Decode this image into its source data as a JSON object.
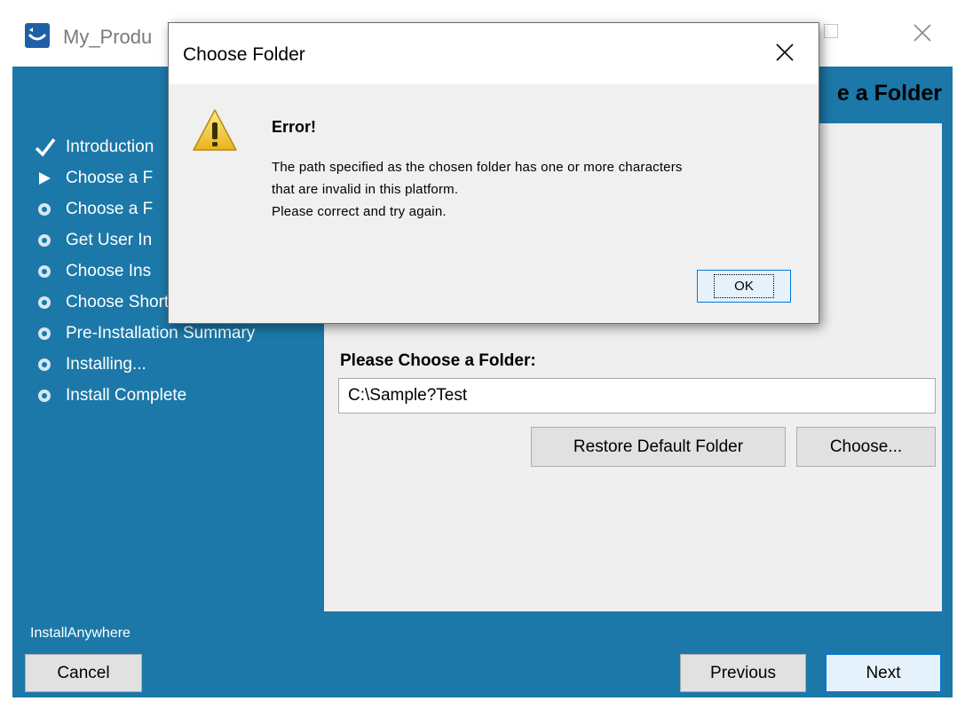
{
  "window": {
    "title": "My_Produ",
    "heading": "e a Folder"
  },
  "steps": [
    {
      "label": "Introduction",
      "state": "done",
      "icon": "checkmark-icon"
    },
    {
      "label": "Choose a F",
      "state": "current",
      "icon": "arrow-right-icon"
    },
    {
      "label": "Choose a F",
      "state": "pending",
      "icon": "bullet-icon"
    },
    {
      "label": "Get User In",
      "state": "pending",
      "icon": "bullet-icon"
    },
    {
      "label": "Choose Ins",
      "state": "pending",
      "icon": "bullet-icon"
    },
    {
      "label": "Choose Shortcut Folder",
      "state": "pending",
      "icon": "bullet-icon"
    },
    {
      "label": "Pre-Installation Summary",
      "state": "pending",
      "icon": "bullet-icon"
    },
    {
      "label": "Installing...",
      "state": "pending",
      "icon": "bullet-icon"
    },
    {
      "label": "Install Complete",
      "state": "pending",
      "icon": "bullet-icon"
    }
  ],
  "content": {
    "field_label": "Please Choose a Folder:",
    "folder_value": "C:\\Sample?Test",
    "restore_button": "Restore Default Folder",
    "choose_button": "Choose..."
  },
  "footer": {
    "brand": "InstallAnywhere",
    "cancel": "Cancel",
    "previous": "Previous",
    "next": "Next"
  },
  "dialog": {
    "title": "Choose Folder",
    "error_title": "Error!",
    "message_lines": [
      "The path specified as the chosen folder has one or more characters",
      "that are invalid in this platform.",
      "Please correct and try again."
    ],
    "ok": "OK"
  },
  "colors": {
    "body_bg": "#1c78a8",
    "panel_bg": "#efefef",
    "dialog_bg": "#f0f0f0",
    "button_bg": "#e1e1e1",
    "focus_border": "#0078d7",
    "warning_yellow": "#f7d13a"
  }
}
